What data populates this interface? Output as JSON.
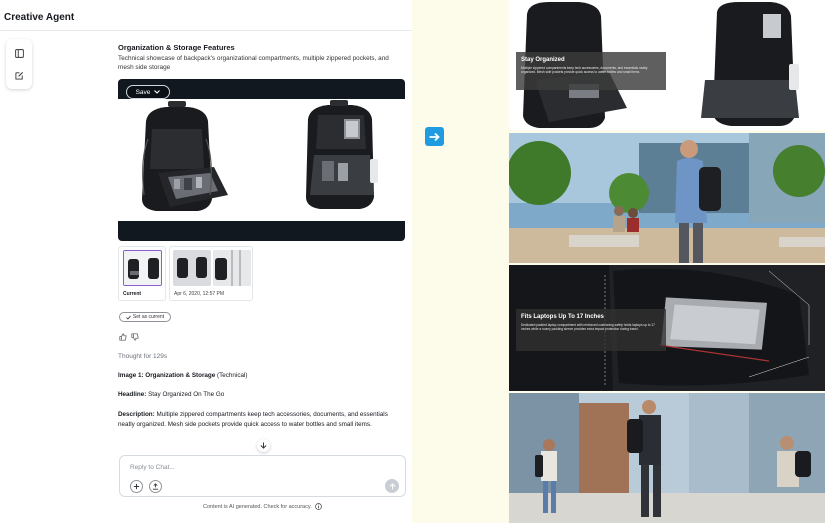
{
  "app": {
    "title": "Creative Agent"
  },
  "feature": {
    "title": "Organization & Storage Features",
    "description": "Technical showcase of backpack's organizational compartments, multiple zippered pockets, and mesh side storage"
  },
  "image_toolbar": {
    "save_label": "Save"
  },
  "versions": [
    {
      "label": "Current"
    },
    {
      "label": "Apr 6, 2020, 12:57 PM"
    }
  ],
  "set_current_label": "Set as current",
  "thought": "Thought for 129s",
  "details": {
    "image_label": "Image 1: Organization & Storage",
    "image_suffix": " (Technical)",
    "headline_label": "Headline:",
    "headline_value": " Stay Organized On The Go",
    "description_label": "Description:",
    "description_value": " Multiple zippered compartments keep tech accessories, documents, and essentials neatly organized. Mesh side pockets provide quick access to water bottles and small items."
  },
  "chat": {
    "placeholder": "Reply to Chat..."
  },
  "disclaimer": "Content is AI generated. Check for accuracy.",
  "gallery": [
    {
      "title": "Stay Organized",
      "body": "Multiple zippered compartments keep tech accessories, documents, and essentials neatly organized. Mesh side pockets provide quick access to water bottles and small items."
    },
    {
      "title": "",
      "body": ""
    },
    {
      "title": "Fits Laptops Up To 17 Inches",
      "body": "Dedicated padded laptop compartment with reinforced cushioning safely holds laptops up to 17 inches while a roomy padding sleeve provides extra impact protection during travel."
    },
    {
      "title": "",
      "body": ""
    }
  ],
  "colors": {
    "accent": "#1f9be0",
    "page_background": "#fdfbea",
    "panel_background": "#ffffff",
    "image_frame": "#111820"
  }
}
